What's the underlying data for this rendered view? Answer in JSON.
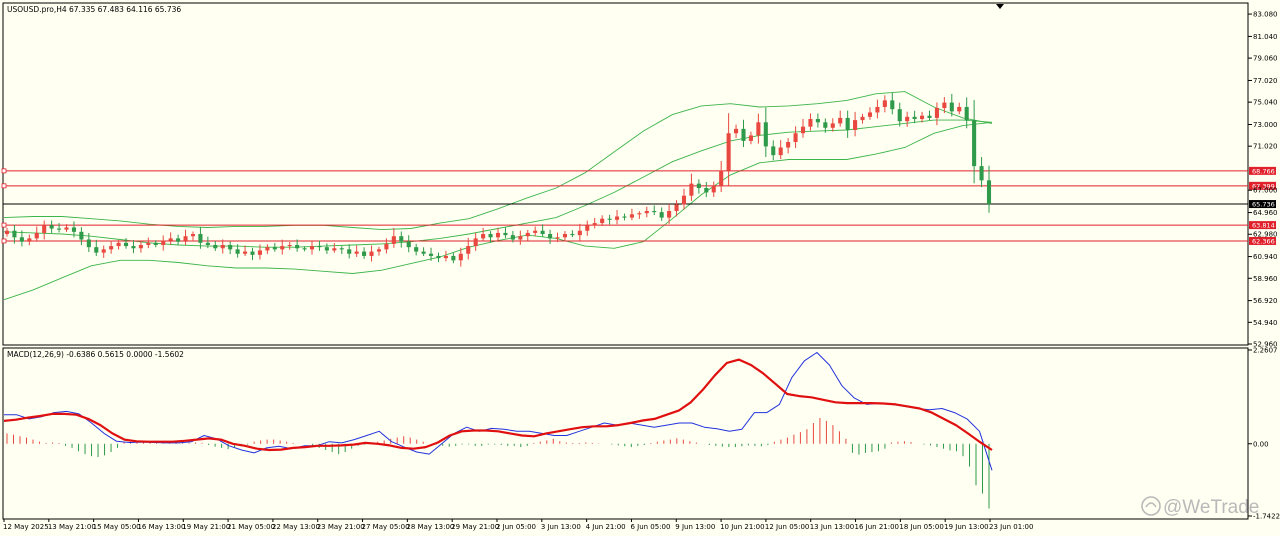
{
  "header": {
    "symbol_line": "USOUSD.pro,H4  67.335 67.483 64.116 65.736",
    "macd_line": "MACD(12,26,9) -0.6386 0.5615 0.0000 -1.5602"
  },
  "watermark": "@WeTrade",
  "colors": {
    "bull": "#e8483f",
    "bear": "#2e9a4a",
    "bollinger": "#3cb54a",
    "hline": "#e0202a",
    "current_price_line": "#000000",
    "macd_main": "#2233dd",
    "macd_signal": "#e01010",
    "hist_pos": "#e8483f",
    "hist_neg": "#2e9a4a"
  },
  "chart_data": [
    {
      "type": "candlestick",
      "title": "USOUSD.pro,H4",
      "ylim": [
        52.96,
        84.0
      ],
      "y_ticks": [
        "83.080",
        "81.040",
        "79.060",
        "77.020",
        "75.040",
        "73.000",
        "71.020",
        "67.000",
        "64.960",
        "62.980",
        "60.940",
        "58.960",
        "56.920",
        "54.940",
        "52.960"
      ],
      "x_ticks": [
        "12 May 2025",
        "13 May 21:00",
        "15 May 05:00",
        "16 May 13:00",
        "19 May 21:00",
        "21 May 05:00",
        "22 May 13:00",
        "23 May 21:00",
        "27 May 05:00",
        "28 May 13:00",
        "29 May 21:00",
        "2 Jun 05:00",
        "3 Jun 13:00",
        "4 Jun 21:00",
        "6 Jun 05:00",
        "9 Jun 13:00",
        "10 Jun 21:00",
        "12 Jun 05:00",
        "13 Jun 13:00",
        "16 Jun 21:00",
        "18 Jun 05:00",
        "19 Jun 13:00",
        "23 Jun 01:00"
      ],
      "close": [
        63.3,
        62.7,
        62.3,
        62.6,
        63.1,
        63.8,
        63.5,
        63.4,
        63.6,
        63.2,
        62.5,
        61.8,
        61.3,
        61.6,
        61.9,
        62.2,
        61.9,
        61.7,
        62.0,
        62.2,
        62.0,
        62.4,
        62.6,
        62.3,
        62.8,
        63.0,
        62.2,
        62.0,
        61.7,
        62.0,
        61.6,
        61.2,
        61.4,
        61.1,
        61.5,
        61.8,
        61.6,
        61.9,
        62.0,
        61.7,
        61.6,
        61.9,
        61.8,
        61.5,
        61.7,
        61.6,
        61.2,
        61.4,
        61.0,
        61.4,
        61.6,
        62.1,
        62.8,
        62.3,
        61.8,
        61.4,
        61.2,
        61.0,
        60.8,
        61.0,
        60.6,
        61.2,
        61.9,
        62.6,
        63.0,
        62.7,
        63.1,
        62.9,
        62.5,
        62.8,
        63.1,
        63.3,
        63.0,
        62.6,
        62.7,
        63.0,
        62.9,
        63.3,
        63.8,
        64.0,
        64.4,
        64.3,
        64.6,
        64.5,
        64.8,
        64.9,
        65.1,
        65.0,
        64.5,
        65.1,
        65.7,
        66.5,
        67.6,
        67.2,
        66.8,
        67.4,
        68.8,
        72.2,
        72.6,
        71.5,
        72.0,
        73.2,
        71.0,
        70.2,
        70.9,
        71.4,
        72.2,
        72.8,
        73.5,
        73.2,
        72.7,
        73.1,
        73.6,
        72.5,
        73.4,
        73.7,
        74.1,
        74.6,
        75.2,
        74.4,
        73.3,
        73.7,
        73.5,
        73.8,
        73.6,
        74.5,
        75.0,
        74.2,
        74.6,
        73.4,
        69.2,
        67.9,
        65.736
      ],
      "bollinger_upper": [
        64.5,
        64.6,
        64.6,
        64.4,
        64.2,
        63.9,
        63.7,
        63.6,
        63.7,
        63.7,
        63.8,
        63.8,
        63.6,
        63.4,
        63.5,
        64.0,
        64.4,
        65.3,
        66.3,
        67.2,
        68.6,
        70.5,
        72.4,
        73.9,
        74.7,
        74.9,
        74.6,
        74.7,
        74.9,
        75.2,
        75.8,
        76.0,
        74.6,
        73.6,
        73.1
      ],
      "bollinger_mid": [
        63.2,
        63.1,
        63.0,
        62.8,
        62.5,
        62.2,
        62.0,
        61.9,
        61.9,
        61.8,
        61.8,
        61.9,
        62.0,
        62.1,
        62.3,
        62.6,
        63.0,
        63.5,
        64.0,
        64.5,
        65.6,
        66.8,
        68.2,
        69.6,
        70.6,
        71.5,
        72.0,
        72.3,
        72.4,
        72.5,
        72.8,
        73.1,
        73.4,
        73.4,
        73.2
      ],
      "bollinger_lower": [
        57.0,
        57.9,
        59.0,
        60.1,
        60.6,
        60.6,
        60.4,
        60.1,
        59.9,
        59.9,
        59.8,
        59.6,
        59.4,
        59.7,
        60.3,
        60.9,
        61.8,
        62.4,
        62.9,
        62.6,
        61.9,
        61.7,
        62.3,
        64.4,
        66.6,
        68.4,
        69.5,
        69.8,
        69.8,
        69.8,
        70.3,
        70.9,
        72.2,
        72.9,
        73.2
      ],
      "horizontal_lines": [
        {
          "value": 68.766,
          "label": "68.766"
        },
        {
          "value": 67.399,
          "label": "67.399"
        },
        {
          "value": 63.814,
          "label": "63.814"
        },
        {
          "value": 62.366,
          "label": "62.366"
        }
      ],
      "current_price": {
        "value": 65.736,
        "label": "65.736"
      }
    },
    {
      "type": "macd",
      "title": "MACD(12,26,9)",
      "ylim": [
        -1.7422,
        2.2607
      ],
      "y_ticks": [
        "2.2607",
        "0.00",
        "-1.7422"
      ],
      "macd_line": [
        0.7,
        0.7,
        0.6,
        0.65,
        0.75,
        0.78,
        0.72,
        0.5,
        0.25,
        0.06,
        0.03,
        0.04,
        0.03,
        0.02,
        0.02,
        0.05,
        0.2,
        0.12,
        -0.05,
        -0.15,
        -0.22,
        -0.1,
        -0.06,
        -0.12,
        -0.05,
        -0.05,
        0.05,
        0.02,
        0.1,
        0.2,
        0.3,
        0.05,
        -0.08,
        -0.2,
        -0.25,
        0.0,
        0.25,
        0.4,
        0.3,
        0.37,
        0.35,
        0.3,
        0.3,
        0.25,
        0.2,
        0.2,
        0.3,
        0.4,
        0.5,
        0.45,
        0.5,
        0.45,
        0.4,
        0.45,
        0.5,
        0.5,
        0.4,
        0.36,
        0.3,
        0.35,
        0.75,
        0.75,
        0.95,
        1.6,
        2.0,
        2.2,
        1.9,
        1.4,
        1.1,
        0.95,
        0.98,
        0.95,
        0.9,
        0.85,
        0.82,
        0.85,
        0.75,
        0.6,
        0.3,
        -0.64
      ],
      "signal_line": [
        0.55,
        0.58,
        0.63,
        0.67,
        0.72,
        0.72,
        0.7,
        0.6,
        0.45,
        0.25,
        0.1,
        0.06,
        0.05,
        0.05,
        0.05,
        0.07,
        0.1,
        0.13,
        0.1,
        0.0,
        -0.05,
        -0.12,
        -0.15,
        -0.14,
        -0.1,
        -0.08,
        -0.05,
        -0.05,
        -0.04,
        -0.02,
        0.02,
        0.0,
        -0.04,
        -0.1,
        -0.12,
        -0.08,
        0.03,
        0.2,
        0.3,
        0.32,
        0.32,
        0.3,
        0.25,
        0.2,
        0.18,
        0.25,
        0.3,
        0.35,
        0.4,
        0.42,
        0.42,
        0.45,
        0.5,
        0.56,
        0.6,
        0.7,
        0.8,
        1.0,
        1.3,
        1.65,
        1.95,
        2.03,
        1.9,
        1.7,
        1.45,
        1.2,
        1.15,
        1.12,
        1.06,
        1.0,
        0.98,
        0.98,
        0.98,
        0.97,
        0.95,
        0.9,
        0.85,
        0.75,
        0.6,
        0.45,
        0.25,
        0.04,
        -0.15
      ],
      "histogram": [
        0.25,
        0.22,
        0.18,
        0.15,
        0.1,
        0.05,
        0.02,
        0.03,
        0.02,
        -0.05,
        -0.1,
        -0.18,
        -0.25,
        -0.3,
        -0.32,
        -0.28,
        -0.2,
        -0.1,
        0.03,
        0.05,
        0.06,
        0.06,
        0.05,
        0.05,
        0.05,
        0.04,
        0.03,
        0.02,
        0.02,
        0.03,
        0.02,
        -0.03,
        -0.07,
        -0.1,
        -0.13,
        -0.1,
        -0.06,
        -0.02,
        0.05,
        0.08,
        0.1,
        0.1,
        0.08,
        0.05,
        0.02,
        0.0,
        0.0,
        -0.05,
        -0.1,
        -0.15,
        -0.2,
        -0.25,
        -0.2,
        -0.12,
        -0.05,
        -0.02,
        0.0,
        0.05,
        0.08,
        0.12,
        0.15,
        0.18,
        0.15,
        0.1,
        0.05,
        0.0,
        -0.02,
        -0.05,
        -0.07,
        -0.05,
        -0.02,
        -0.02,
        -0.05,
        -0.05,
        -0.02,
        -0.02,
        -0.03,
        -0.05,
        -0.05,
        -0.08,
        -0.05,
        0.02,
        0.05,
        0.08,
        0.12,
        0.06,
        0.03,
        0.02,
        0.02,
        0.03,
        0.02,
        0.01,
        0.0,
        -0.02,
        -0.04,
        -0.06,
        -0.08,
        -0.05,
        -0.03,
        0.02,
        0.05,
        0.08,
        0.1,
        0.13,
        0.1,
        0.06,
        0.03,
        0.0,
        -0.03,
        -0.05,
        -0.07,
        -0.08,
        -0.08,
        -0.06,
        -0.04,
        -0.05,
        -0.06,
        -0.03,
        0.05,
        0.1,
        0.15,
        0.22,
        0.28,
        0.35,
        0.5,
        0.62,
        0.55,
        0.45,
        0.3,
        0.12,
        -0.22,
        -0.26,
        -0.22,
        -0.2,
        -0.18,
        -0.12,
        0.03,
        0.05,
        0.06,
        0.04,
        0.0,
        -0.02,
        -0.04,
        -0.08,
        -0.12,
        -0.16,
        -0.18,
        -0.3,
        -0.55,
        -1.0,
        -1.2,
        -1.56
      ]
    }
  ]
}
